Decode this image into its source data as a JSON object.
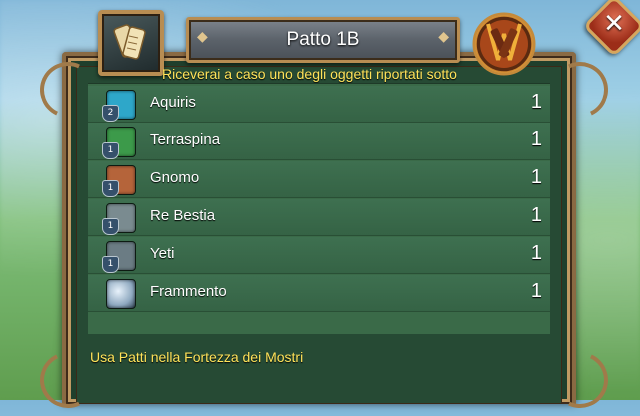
{
  "dialog": {
    "title": "Patto 1B",
    "subtitle": "Riceverai a caso uno degli oggetti riportati sotto",
    "footer": "Usa Patti nella Fortezza dei Mostri",
    "close_label": "✕"
  },
  "items": [
    {
      "name": "Aquiris",
      "count": "1",
      "level": "2",
      "icon": "aquiris-icon",
      "color": "#2ea7c9"
    },
    {
      "name": "Terraspina",
      "count": "1",
      "level": "1",
      "icon": "terraspina-icon",
      "color": "#3c9a4a"
    },
    {
      "name": "Gnomo",
      "count": "1",
      "level": "1",
      "icon": "gnomo-icon",
      "color": "#b5643a"
    },
    {
      "name": "Re Bestia",
      "count": "1",
      "level": "1",
      "icon": "re-bestia-icon",
      "color": "#7a8b90"
    },
    {
      "name": "Yeti",
      "count": "1",
      "level": "1",
      "icon": "yeti-icon",
      "color": "#6b7c84"
    },
    {
      "name": "Frammento",
      "count": "1",
      "level": "",
      "icon": "fragment-icon",
      "color": "#8fa9c0"
    }
  ],
  "colors": {
    "accent_gold": "#ffe35a",
    "panel_green": "#264a34",
    "close_red": "#b83a20"
  }
}
